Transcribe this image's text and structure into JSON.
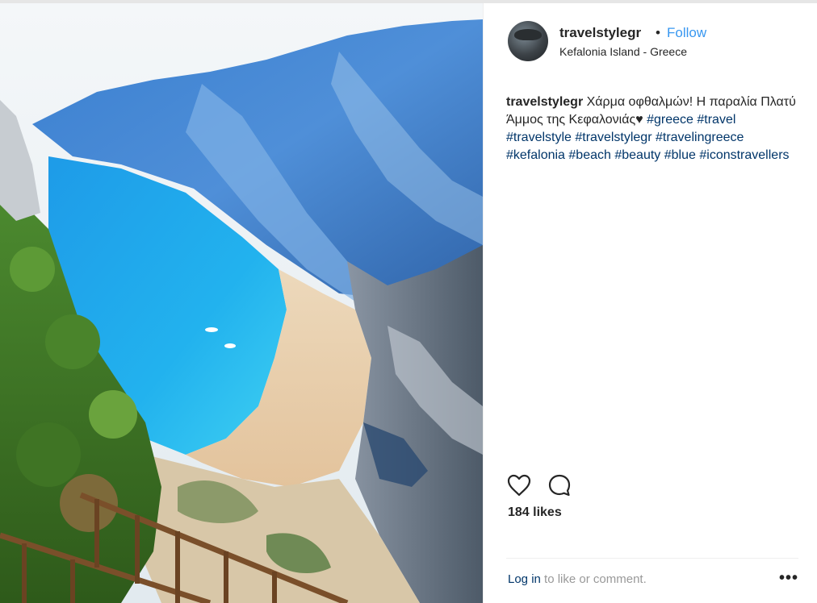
{
  "post": {
    "username": "travelstylegr",
    "separator": "•",
    "follow_label": "Follow",
    "location": "Kefalonia Island - Greece",
    "caption_user": "travelstylegr",
    "caption_text": " Χάρμα οφθαλμών! Η παραλία Πλατύ Άμμος της Κεφαλονιάς♥ ",
    "hashtags": [
      "#greece",
      "#travel",
      "#travelstyle",
      "#travelstylegr",
      "#travelingreece",
      "#kefalonia",
      "#beach",
      "#beauty",
      "#blue",
      "#iconstravellers"
    ],
    "likes": "184 likes",
    "timestamp": "",
    "login_link": "Log in",
    "login_text": " to like or comment.",
    "more_label": "•••"
  },
  "icons": {
    "heart": "heart-icon",
    "comment": "comment-icon",
    "more": "more-options-icon"
  },
  "colors": {
    "link": "#3897f0",
    "hashtag": "#003569",
    "text": "#262626",
    "muted": "#999999"
  }
}
